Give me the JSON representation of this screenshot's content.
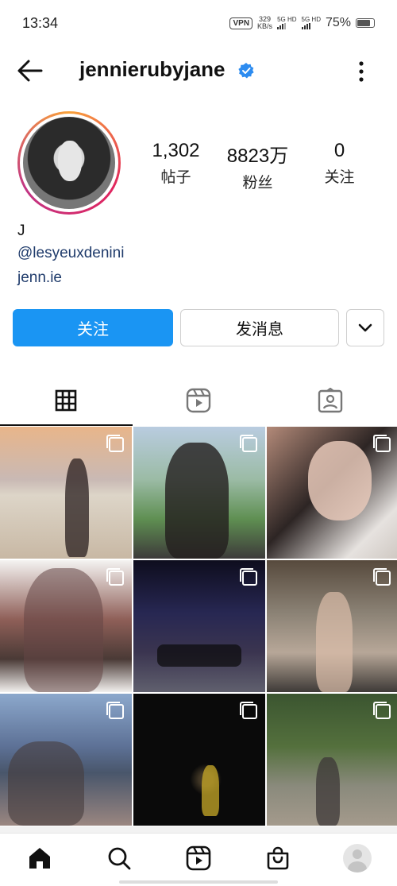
{
  "status_bar": {
    "time": "13:34",
    "vpn": "VPN",
    "net_speed_value": "329",
    "net_speed_unit": "KB/s",
    "sig1": "5G HD",
    "sig2": "5G HD",
    "battery": "75%"
  },
  "header": {
    "username": "jennierubyjane",
    "verified": true
  },
  "profile": {
    "stats": [
      {
        "value": "1,302",
        "label": "帖子"
      },
      {
        "value": "8823万",
        "label": "粉丝"
      },
      {
        "value": "0",
        "label": "关注"
      }
    ],
    "bio_name": "J",
    "bio_links": [
      "@lesyeuxdenini",
      "jenn.ie"
    ]
  },
  "actions": {
    "follow_label": "关注",
    "message_label": "发消息"
  },
  "tabs": [
    {
      "name": "posts",
      "icon": "grid-icon",
      "active": true
    },
    {
      "name": "reels",
      "icon": "reels-icon",
      "active": false
    },
    {
      "name": "tagged",
      "icon": "tagged-person-icon",
      "active": false
    }
  ],
  "grid_posts": [
    {
      "multi": true
    },
    {
      "multi": true
    },
    {
      "multi": true
    },
    {
      "multi": true
    },
    {
      "multi": true
    },
    {
      "multi": true
    },
    {
      "multi": true
    },
    {
      "multi": true
    },
    {
      "multi": true
    }
  ],
  "bottom_nav": [
    "home-icon",
    "search-icon",
    "reels-icon",
    "shop-icon",
    "profile-avatar"
  ],
  "colors": {
    "follow_button": "#1a95f3",
    "link": "#1f3b6b",
    "verified": "#2d8cf0"
  }
}
